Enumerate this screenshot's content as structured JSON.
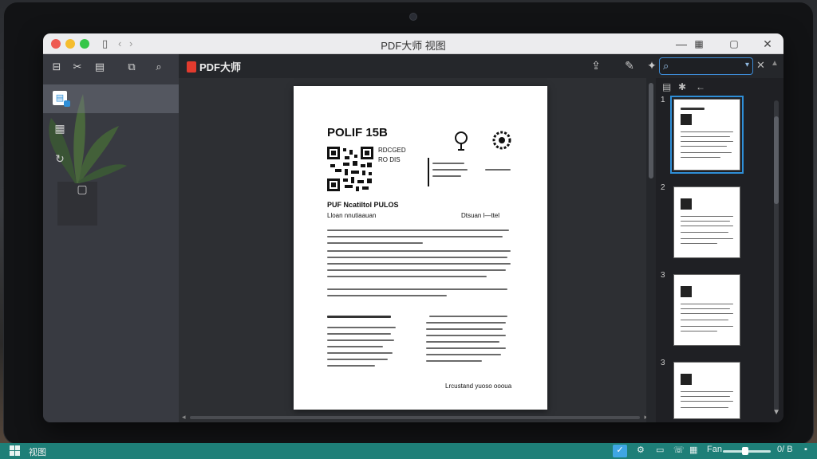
{
  "window": {
    "title": "PDF大师 视图",
    "controls": {
      "minimize": "—",
      "restore": "▢",
      "close": "✕"
    }
  },
  "titlebar_icons": [
    "sidebar-toggle-icon",
    "chevron-left-icon",
    "chevron-right-icon"
  ],
  "app": {
    "logo_text": "PDF大师",
    "search": {
      "placeholder": "",
      "value": ""
    }
  },
  "document": {
    "title": "POLIF 15B",
    "code_labels": [
      "RDCGED",
      "RO DIS"
    ],
    "subtitle": "PUF NcatiItol PULOS",
    "author_line": "Lloan nnutiaauan",
    "date_line": "Dtsuan  l—ttel",
    "signature": "Lrcustand yuoso  oooua"
  },
  "thumbnails": {
    "pages": [
      "1",
      "2",
      "3",
      "3"
    ],
    "active_index": 0
  },
  "taskbar": {
    "label": "视图",
    "zoom_label": "Fan",
    "tray_text": "0/ B"
  },
  "colors": {
    "accent": "#2f8fd8",
    "taskbar": "#1e7f78",
    "logo": "#e23b2e"
  }
}
